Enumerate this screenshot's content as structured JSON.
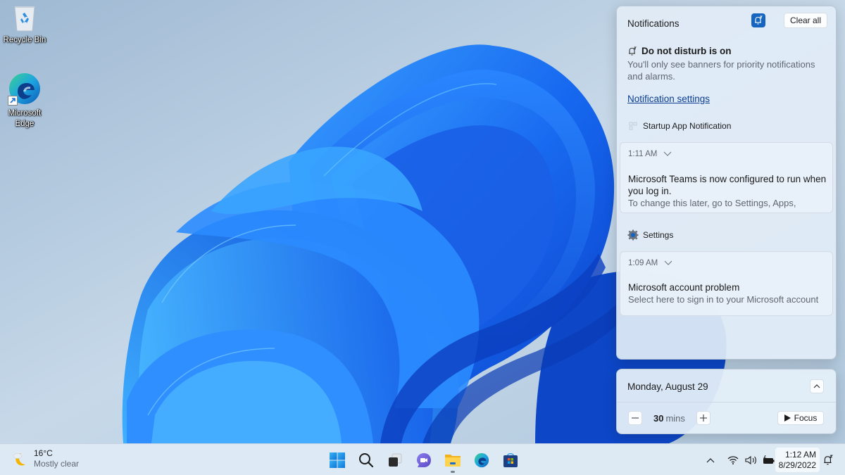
{
  "desktop": {
    "icons": [
      {
        "label": "Recycle Bin",
        "icon": "recycle-bin-icon"
      },
      {
        "label": "Microsoft Edge",
        "icon": "edge-icon"
      }
    ]
  },
  "notification_center": {
    "title": "Notifications",
    "dnd_toggle_icon": "dnd-bell-icon",
    "clear_all_label": "Clear all",
    "dnd": {
      "title": "Do not disturb is on",
      "description": "You'll only see banners for priority notifications and alarms."
    },
    "settings_link": "Notification settings",
    "groups": [
      {
        "app": "Startup App Notification",
        "icon": "startup-app-icon",
        "notifications": [
          {
            "time": "1:11 AM",
            "title": "Microsoft Teams is now configured to run when you log in.",
            "body": "To change this later, go to Settings, Apps,"
          }
        ]
      },
      {
        "app": "Settings",
        "icon": "settings-gear-icon",
        "notifications": [
          {
            "time": "1:09 AM",
            "title": "Microsoft account problem",
            "body": "Select here to sign in to your Microsoft account"
          }
        ]
      }
    ]
  },
  "calendar": {
    "date": "Monday, August 29",
    "focus": {
      "minutes": "30",
      "unit": "mins",
      "button_label": "Focus"
    }
  },
  "taskbar": {
    "weather": {
      "temp": "16°C",
      "condition": "Mostly clear"
    },
    "apps": [
      {
        "name": "Start",
        "icon": "windows-start-icon"
      },
      {
        "name": "Search",
        "icon": "search-icon"
      },
      {
        "name": "Task View",
        "icon": "task-view-icon"
      },
      {
        "name": "Chat",
        "icon": "teams-chat-icon"
      },
      {
        "name": "File Explorer",
        "icon": "file-explorer-icon",
        "running": true
      },
      {
        "name": "Microsoft Edge",
        "icon": "edge-icon"
      },
      {
        "name": "Microsoft Store",
        "icon": "store-icon"
      }
    ],
    "tray": {
      "icons": [
        "chevron-up-icon",
        "wifi-icon",
        "volume-icon",
        "battery-charging-icon"
      ],
      "time": "1:12 AM",
      "date": "8/29/2022"
    }
  },
  "colors": {
    "accent": "#1565c0",
    "link": "#0b3d91",
    "panel_bg": "#e1ecf6",
    "wallpaper_blue": "#1a6ef0"
  }
}
